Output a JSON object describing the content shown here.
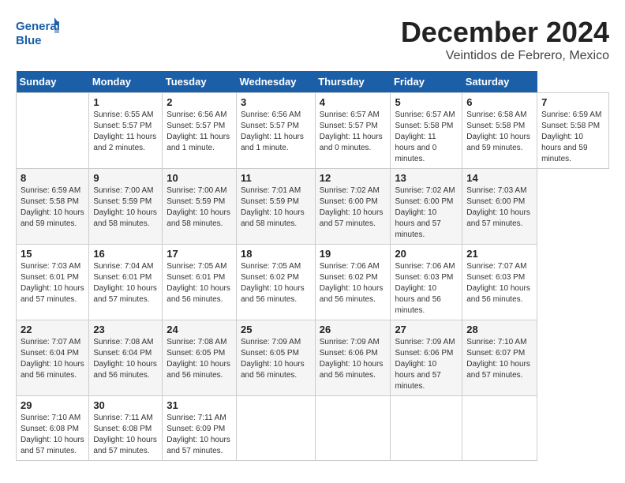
{
  "header": {
    "logo_text_general": "General",
    "logo_text_blue": "Blue",
    "month_title": "December 2024",
    "location": "Veintidos de Febrero, Mexico"
  },
  "calendar": {
    "days_of_week": [
      "Sunday",
      "Monday",
      "Tuesday",
      "Wednesday",
      "Thursday",
      "Friday",
      "Saturday"
    ],
    "weeks": [
      [
        null,
        {
          "day": "1",
          "sunrise": "Sunrise: 6:55 AM",
          "sunset": "Sunset: 5:57 PM",
          "daylight": "Daylight: 11 hours and 2 minutes."
        },
        {
          "day": "2",
          "sunrise": "Sunrise: 6:56 AM",
          "sunset": "Sunset: 5:57 PM",
          "daylight": "Daylight: 11 hours and 1 minute."
        },
        {
          "day": "3",
          "sunrise": "Sunrise: 6:56 AM",
          "sunset": "Sunset: 5:57 PM",
          "daylight": "Daylight: 11 hours and 1 minute."
        },
        {
          "day": "4",
          "sunrise": "Sunrise: 6:57 AM",
          "sunset": "Sunset: 5:57 PM",
          "daylight": "Daylight: 11 hours and 0 minutes."
        },
        {
          "day": "5",
          "sunrise": "Sunrise: 6:57 AM",
          "sunset": "Sunset: 5:58 PM",
          "daylight": "Daylight: 11 hours and 0 minutes."
        },
        {
          "day": "6",
          "sunrise": "Sunrise: 6:58 AM",
          "sunset": "Sunset: 5:58 PM",
          "daylight": "Daylight: 10 hours and 59 minutes."
        },
        {
          "day": "7",
          "sunrise": "Sunrise: 6:59 AM",
          "sunset": "Sunset: 5:58 PM",
          "daylight": "Daylight: 10 hours and 59 minutes."
        }
      ],
      [
        {
          "day": "8",
          "sunrise": "Sunrise: 6:59 AM",
          "sunset": "Sunset: 5:58 PM",
          "daylight": "Daylight: 10 hours and 59 minutes."
        },
        {
          "day": "9",
          "sunrise": "Sunrise: 7:00 AM",
          "sunset": "Sunset: 5:59 PM",
          "daylight": "Daylight: 10 hours and 58 minutes."
        },
        {
          "day": "10",
          "sunrise": "Sunrise: 7:00 AM",
          "sunset": "Sunset: 5:59 PM",
          "daylight": "Daylight: 10 hours and 58 minutes."
        },
        {
          "day": "11",
          "sunrise": "Sunrise: 7:01 AM",
          "sunset": "Sunset: 5:59 PM",
          "daylight": "Daylight: 10 hours and 58 minutes."
        },
        {
          "day": "12",
          "sunrise": "Sunrise: 7:02 AM",
          "sunset": "Sunset: 6:00 PM",
          "daylight": "Daylight: 10 hours and 57 minutes."
        },
        {
          "day": "13",
          "sunrise": "Sunrise: 7:02 AM",
          "sunset": "Sunset: 6:00 PM",
          "daylight": "Daylight: 10 hours and 57 minutes."
        },
        {
          "day": "14",
          "sunrise": "Sunrise: 7:03 AM",
          "sunset": "Sunset: 6:00 PM",
          "daylight": "Daylight: 10 hours and 57 minutes."
        }
      ],
      [
        {
          "day": "15",
          "sunrise": "Sunrise: 7:03 AM",
          "sunset": "Sunset: 6:01 PM",
          "daylight": "Daylight: 10 hours and 57 minutes."
        },
        {
          "day": "16",
          "sunrise": "Sunrise: 7:04 AM",
          "sunset": "Sunset: 6:01 PM",
          "daylight": "Daylight: 10 hours and 57 minutes."
        },
        {
          "day": "17",
          "sunrise": "Sunrise: 7:05 AM",
          "sunset": "Sunset: 6:01 PM",
          "daylight": "Daylight: 10 hours and 56 minutes."
        },
        {
          "day": "18",
          "sunrise": "Sunrise: 7:05 AM",
          "sunset": "Sunset: 6:02 PM",
          "daylight": "Daylight: 10 hours and 56 minutes."
        },
        {
          "day": "19",
          "sunrise": "Sunrise: 7:06 AM",
          "sunset": "Sunset: 6:02 PM",
          "daylight": "Daylight: 10 hours and 56 minutes."
        },
        {
          "day": "20",
          "sunrise": "Sunrise: 7:06 AM",
          "sunset": "Sunset: 6:03 PM",
          "daylight": "Daylight: 10 hours and 56 minutes."
        },
        {
          "day": "21",
          "sunrise": "Sunrise: 7:07 AM",
          "sunset": "Sunset: 6:03 PM",
          "daylight": "Daylight: 10 hours and 56 minutes."
        }
      ],
      [
        {
          "day": "22",
          "sunrise": "Sunrise: 7:07 AM",
          "sunset": "Sunset: 6:04 PM",
          "daylight": "Daylight: 10 hours and 56 minutes."
        },
        {
          "day": "23",
          "sunrise": "Sunrise: 7:08 AM",
          "sunset": "Sunset: 6:04 PM",
          "daylight": "Daylight: 10 hours and 56 minutes."
        },
        {
          "day": "24",
          "sunrise": "Sunrise: 7:08 AM",
          "sunset": "Sunset: 6:05 PM",
          "daylight": "Daylight: 10 hours and 56 minutes."
        },
        {
          "day": "25",
          "sunrise": "Sunrise: 7:09 AM",
          "sunset": "Sunset: 6:05 PM",
          "daylight": "Daylight: 10 hours and 56 minutes."
        },
        {
          "day": "26",
          "sunrise": "Sunrise: 7:09 AM",
          "sunset": "Sunset: 6:06 PM",
          "daylight": "Daylight: 10 hours and 56 minutes."
        },
        {
          "day": "27",
          "sunrise": "Sunrise: 7:09 AM",
          "sunset": "Sunset: 6:06 PM",
          "daylight": "Daylight: 10 hours and 57 minutes."
        },
        {
          "day": "28",
          "sunrise": "Sunrise: 7:10 AM",
          "sunset": "Sunset: 6:07 PM",
          "daylight": "Daylight: 10 hours and 57 minutes."
        }
      ],
      [
        {
          "day": "29",
          "sunrise": "Sunrise: 7:10 AM",
          "sunset": "Sunset: 6:08 PM",
          "daylight": "Daylight: 10 hours and 57 minutes."
        },
        {
          "day": "30",
          "sunrise": "Sunrise: 7:11 AM",
          "sunset": "Sunset: 6:08 PM",
          "daylight": "Daylight: 10 hours and 57 minutes."
        },
        {
          "day": "31",
          "sunrise": "Sunrise: 7:11 AM",
          "sunset": "Sunset: 6:09 PM",
          "daylight": "Daylight: 10 hours and 57 minutes."
        },
        null,
        null,
        null,
        null
      ]
    ]
  }
}
